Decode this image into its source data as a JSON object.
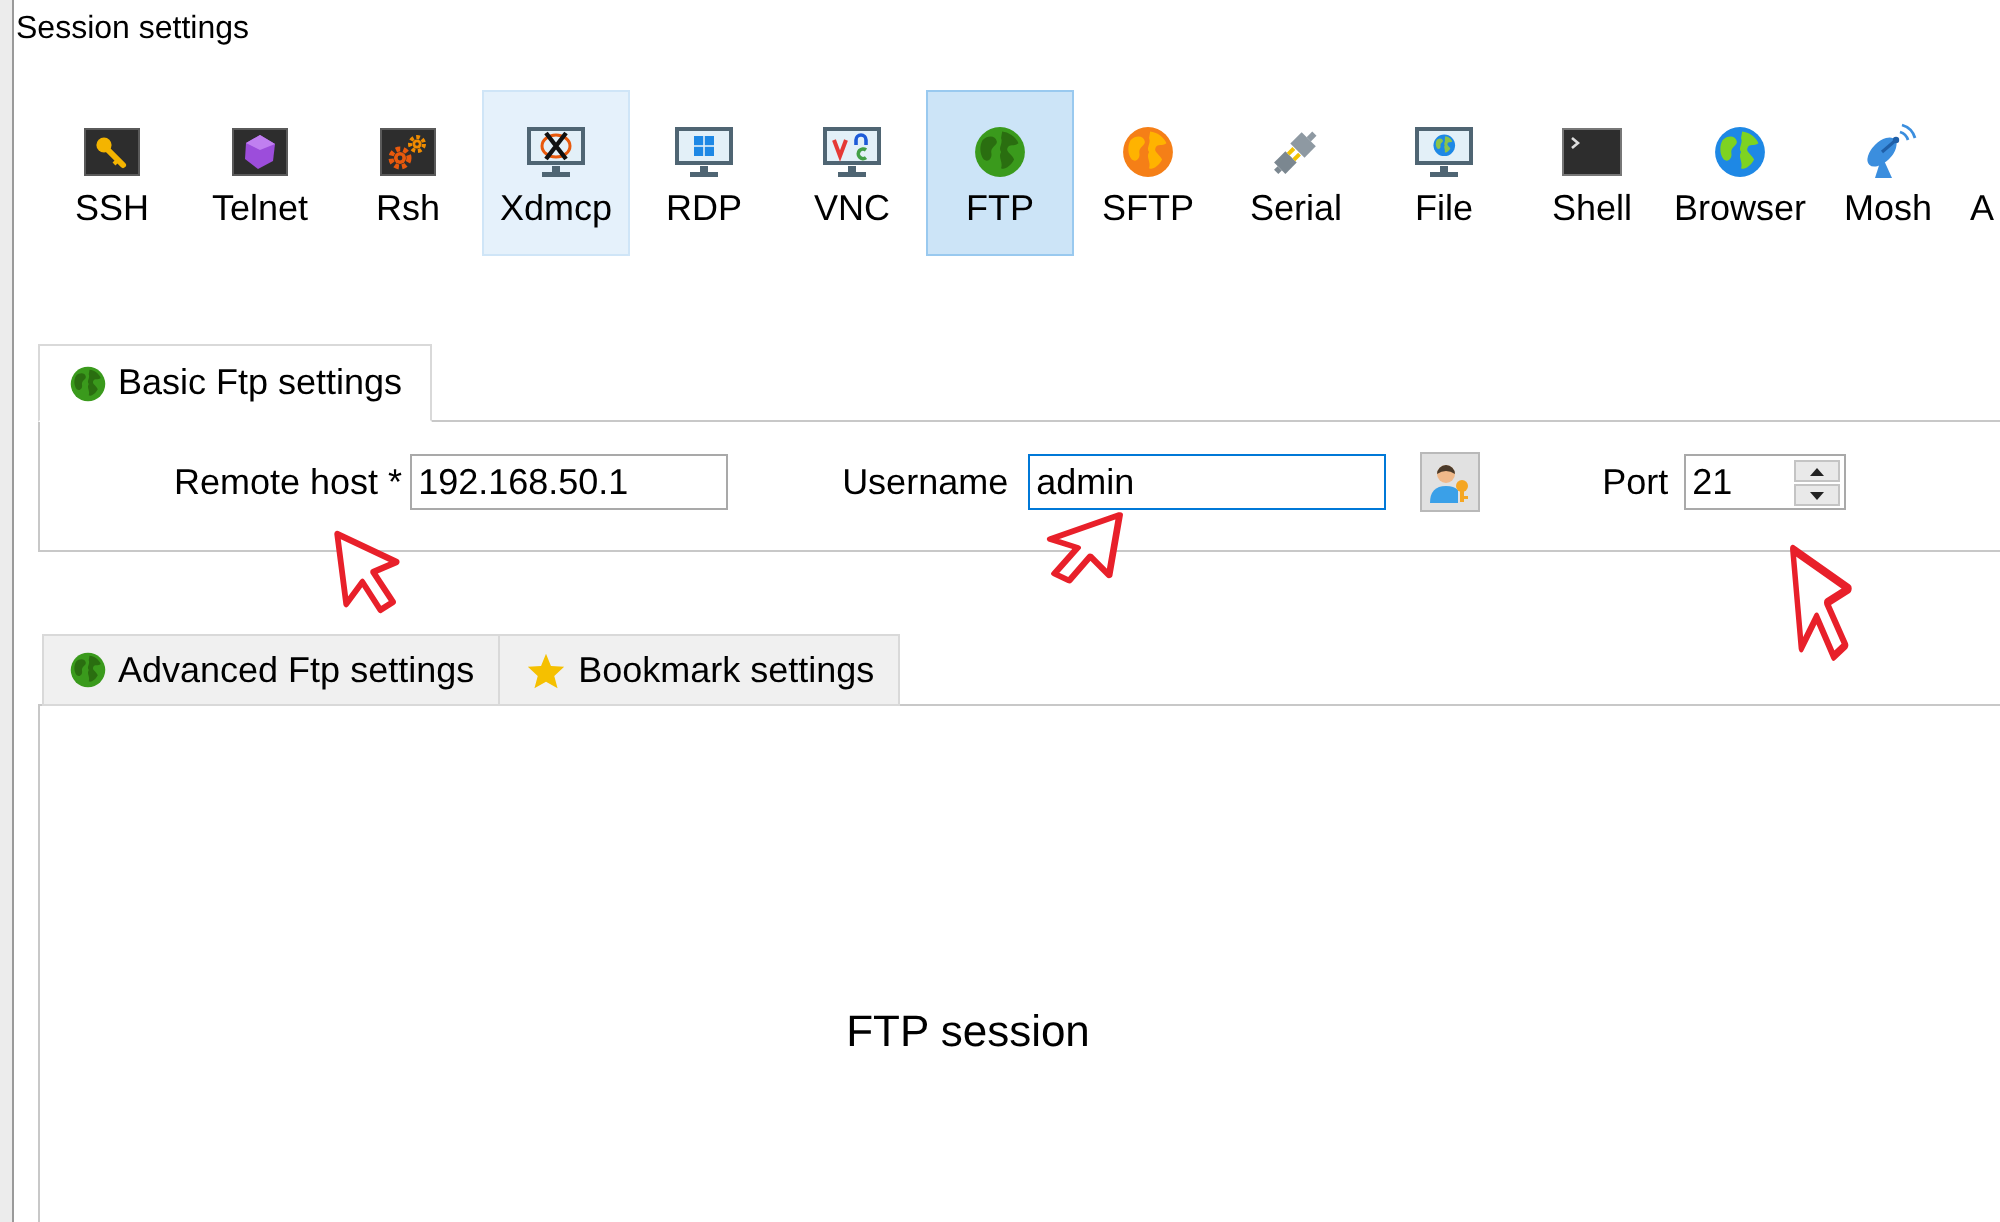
{
  "window": {
    "title": "Session settings"
  },
  "session_types": [
    {
      "label": "SSH",
      "selected": false,
      "hovered": false
    },
    {
      "label": "Telnet",
      "selected": false,
      "hovered": false
    },
    {
      "label": "Rsh",
      "selected": false,
      "hovered": false
    },
    {
      "label": "Xdmcp",
      "selected": false,
      "hovered": true
    },
    {
      "label": "RDP",
      "selected": false,
      "hovered": false
    },
    {
      "label": "VNC",
      "selected": false,
      "hovered": false
    },
    {
      "label": "FTP",
      "selected": true,
      "hovered": false
    },
    {
      "label": "SFTP",
      "selected": false,
      "hovered": false
    },
    {
      "label": "Serial",
      "selected": false,
      "hovered": false
    },
    {
      "label": "File",
      "selected": false,
      "hovered": false
    },
    {
      "label": "Shell",
      "selected": false,
      "hovered": false
    },
    {
      "label": "Browser",
      "selected": false,
      "hovered": false
    },
    {
      "label": "Mosh",
      "selected": false,
      "hovered": false
    },
    {
      "label": "A",
      "selected": false,
      "hovered": false
    }
  ],
  "basic_tabs": [
    {
      "label": "Basic Ftp settings",
      "selected": true
    }
  ],
  "fields": [
    {
      "kind": "text",
      "label": "Remote host *",
      "value": "192.168.50.1",
      "focused": false,
      "marked": true
    },
    {
      "kind": "account",
      "label": "Username",
      "value": "admin",
      "focused": true,
      "marked": true
    },
    {
      "kind": "spin",
      "label": "Port",
      "value": "21",
      "focused": false,
      "marked": true
    }
  ],
  "advanced_tabs": [
    {
      "label": "Advanced Ftp settings",
      "selected": false
    },
    {
      "label": "Bookmark settings",
      "selected": false
    }
  ],
  "session_panel": {
    "text": "FTP session"
  }
}
